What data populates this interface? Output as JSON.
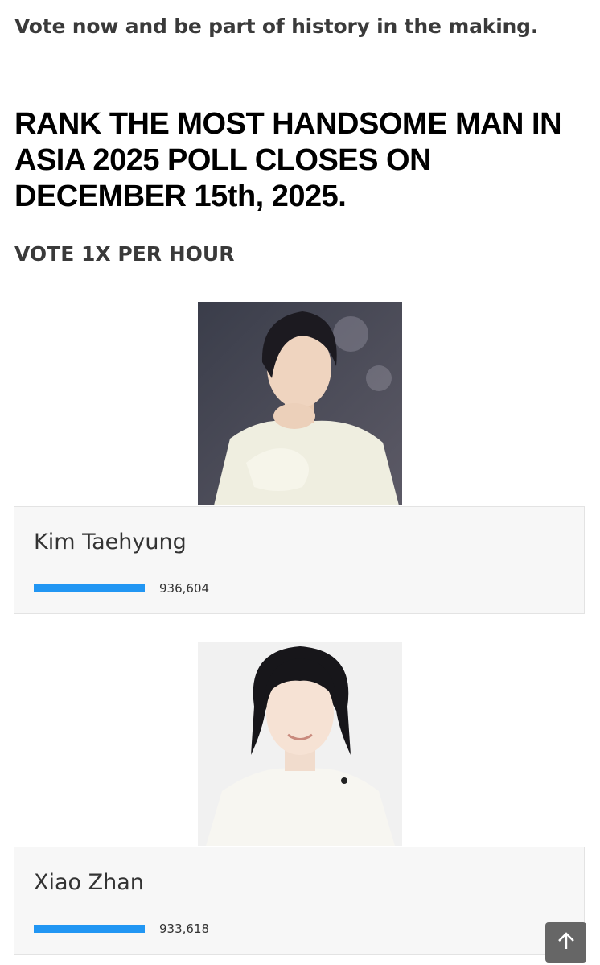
{
  "intro_text": "Vote now and be part of history in the making.",
  "headline": "RANK THE MOST HANDSOME MAN IN ASIA 2025 POLL CLOSES ON DECEMBER 15th, 2025.",
  "subhead": "VOTE 1X PER HOUR",
  "candidates": [
    {
      "name": "Kim Taehyung",
      "votes": "936,604",
      "bar_fraction": 1.0
    },
    {
      "name": "Xiao Zhan",
      "votes": "933,618",
      "bar_fraction": 0.997
    }
  ],
  "scroll_top_icon": "arrow-up-icon",
  "colors": {
    "bar": "#2196f3",
    "card_bg": "#f7f7f7",
    "scroll_button": "#666666"
  }
}
